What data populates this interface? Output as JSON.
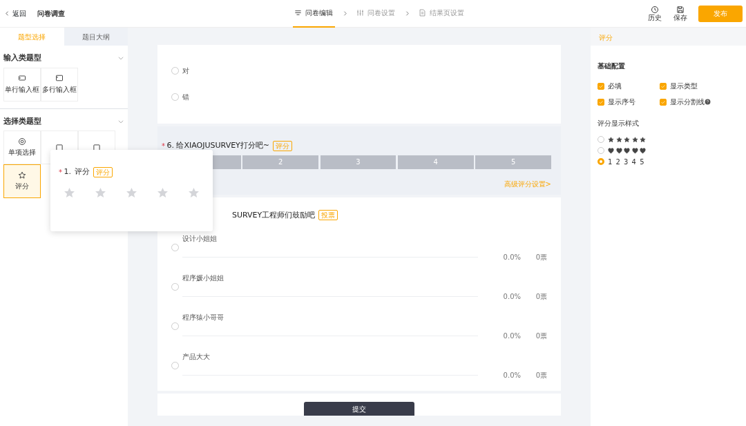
{
  "header": {
    "back": "返回",
    "title": "问卷调查",
    "steps": [
      {
        "label": "问卷编辑",
        "selected": true
      },
      {
        "label": "问卷设置",
        "selected": false
      },
      {
        "label": "结果页设置",
        "selected": false
      }
    ],
    "actions": [
      {
        "label": "历史"
      },
      {
        "label": "保存"
      }
    ],
    "publish": "发布"
  },
  "left_panel": {
    "tabs": [
      {
        "label": "题型选择",
        "selected": true
      },
      {
        "label": "题目大纲",
        "selected": false
      }
    ],
    "groups": [
      {
        "title": "输入类题型",
        "expanded": true,
        "items": [
          {
            "label": "单行输入框",
            "selected": false
          },
          {
            "label": "多行输入框",
            "selected": false
          }
        ]
      },
      {
        "title": "选择类题型",
        "expanded": true,
        "items": [
          {
            "label": "单项选择",
            "selected": false
          },
          {
            "selected": false
          },
          {
            "selected": false
          },
          {
            "label": "评分",
            "selected": true
          }
        ]
      }
    ]
  },
  "popover": {
    "required_mark": "*",
    "number": "1.",
    "title": "评分",
    "tag": "评分",
    "stars": 0
  },
  "questions": [
    {
      "kind": "choice",
      "selected": false,
      "options": [
        {
          "label": "对",
          "selected": false
        },
        {
          "label": "错",
          "selected": false
        }
      ]
    },
    {
      "kind": "rating",
      "selected": true,
      "required_mark": "*",
      "title": "6. 给XIAOJUSURVEY打分吧~",
      "tag": "评分",
      "scale": [
        "2",
        "3",
        "4",
        "5"
      ],
      "link": "高级评分设置>"
    },
    {
      "kind": "vote",
      "selected": false,
      "title": "SURVEY工程师们鼓励吧",
      "tag": "投票",
      "options": [
        {
          "label": "设计小姐姐",
          "selected": false,
          "percent": "0.0%",
          "votes": "0票"
        },
        {
          "label": "程序媛小姐姐",
          "selected": false,
          "percent": "0.0%",
          "votes": "0票"
        },
        {
          "label": "程序猿小哥哥",
          "selected": false,
          "percent": "0.0%",
          "votes": "0票"
        },
        {
          "label": "产品大大",
          "selected": false,
          "percent": "0.0%",
          "votes": "0票"
        }
      ]
    }
  ],
  "submit": "提交",
  "right_panel": {
    "title": "评分",
    "section": "基础配置",
    "checks": [
      {
        "label": "必填",
        "checked": true,
        "help": false
      },
      {
        "label": "显示类型",
        "checked": true,
        "help": false
      },
      {
        "label": "显示序号",
        "checked": true,
        "help": false
      },
      {
        "label": "显示分割线",
        "checked": true,
        "help": true
      }
    ],
    "style_title": "评分显示样式",
    "styles": [
      {
        "kind": "stars",
        "selected": false
      },
      {
        "kind": "hearts",
        "selected": false
      },
      {
        "kind": "numbers",
        "label": "1 2 3 4 5",
        "selected": true
      }
    ]
  }
}
